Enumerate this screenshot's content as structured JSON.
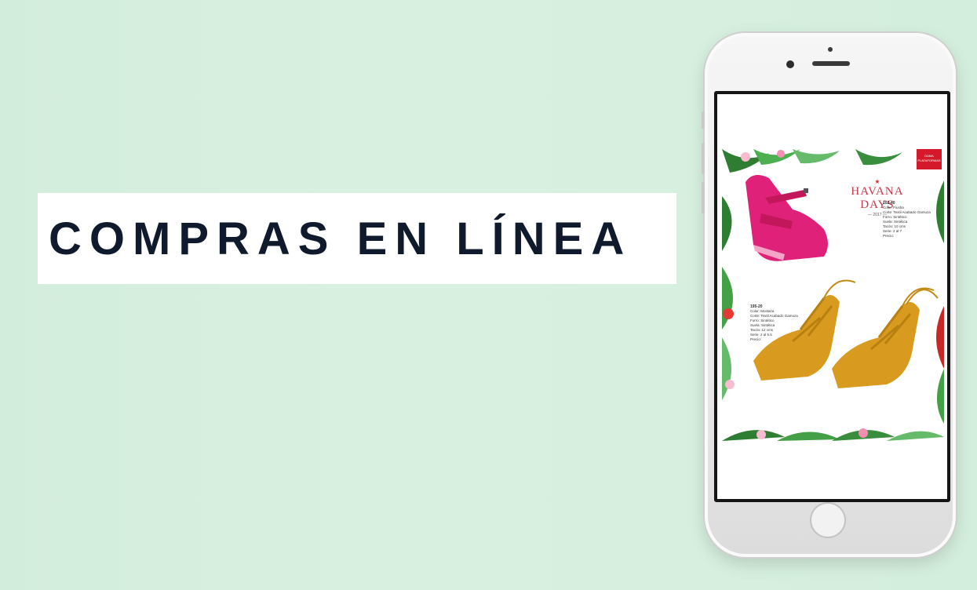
{
  "banner": {
    "title": "COMPRAS EN LÍNEA"
  },
  "catalog": {
    "brand": "HAVANA DAYS",
    "brand_year": "— 2017 —",
    "ribbon_line1": "DAMA",
    "ribbon_line2": "PLATAFORMAS",
    "product_1": {
      "code": "102-40",
      "lines": [
        "Color: Fiusha",
        "Corte: Textil Acabado Gamuza",
        "Forro: Sintético",
        "Suela: Sintética",
        "Tacón: 10 cms",
        "Serie: 2 al 7",
        "Precio:"
      ]
    },
    "product_2": {
      "code": "195-20",
      "lines": [
        "Color: Mostaza",
        "Corte: Textil Acabado Gamuza",
        "Forro: Sintético",
        "Suela: Sintética",
        "Tacón: 12 cms",
        "Serie: 2 al 6.5",
        "Precio:"
      ]
    }
  },
  "colors": {
    "background": "#d6efdf",
    "banner_text": "#0f1a2c",
    "pink_shoe": "#e0217a",
    "mustard_shoe": "#d89a1f",
    "brand_red": "#c8384a"
  }
}
